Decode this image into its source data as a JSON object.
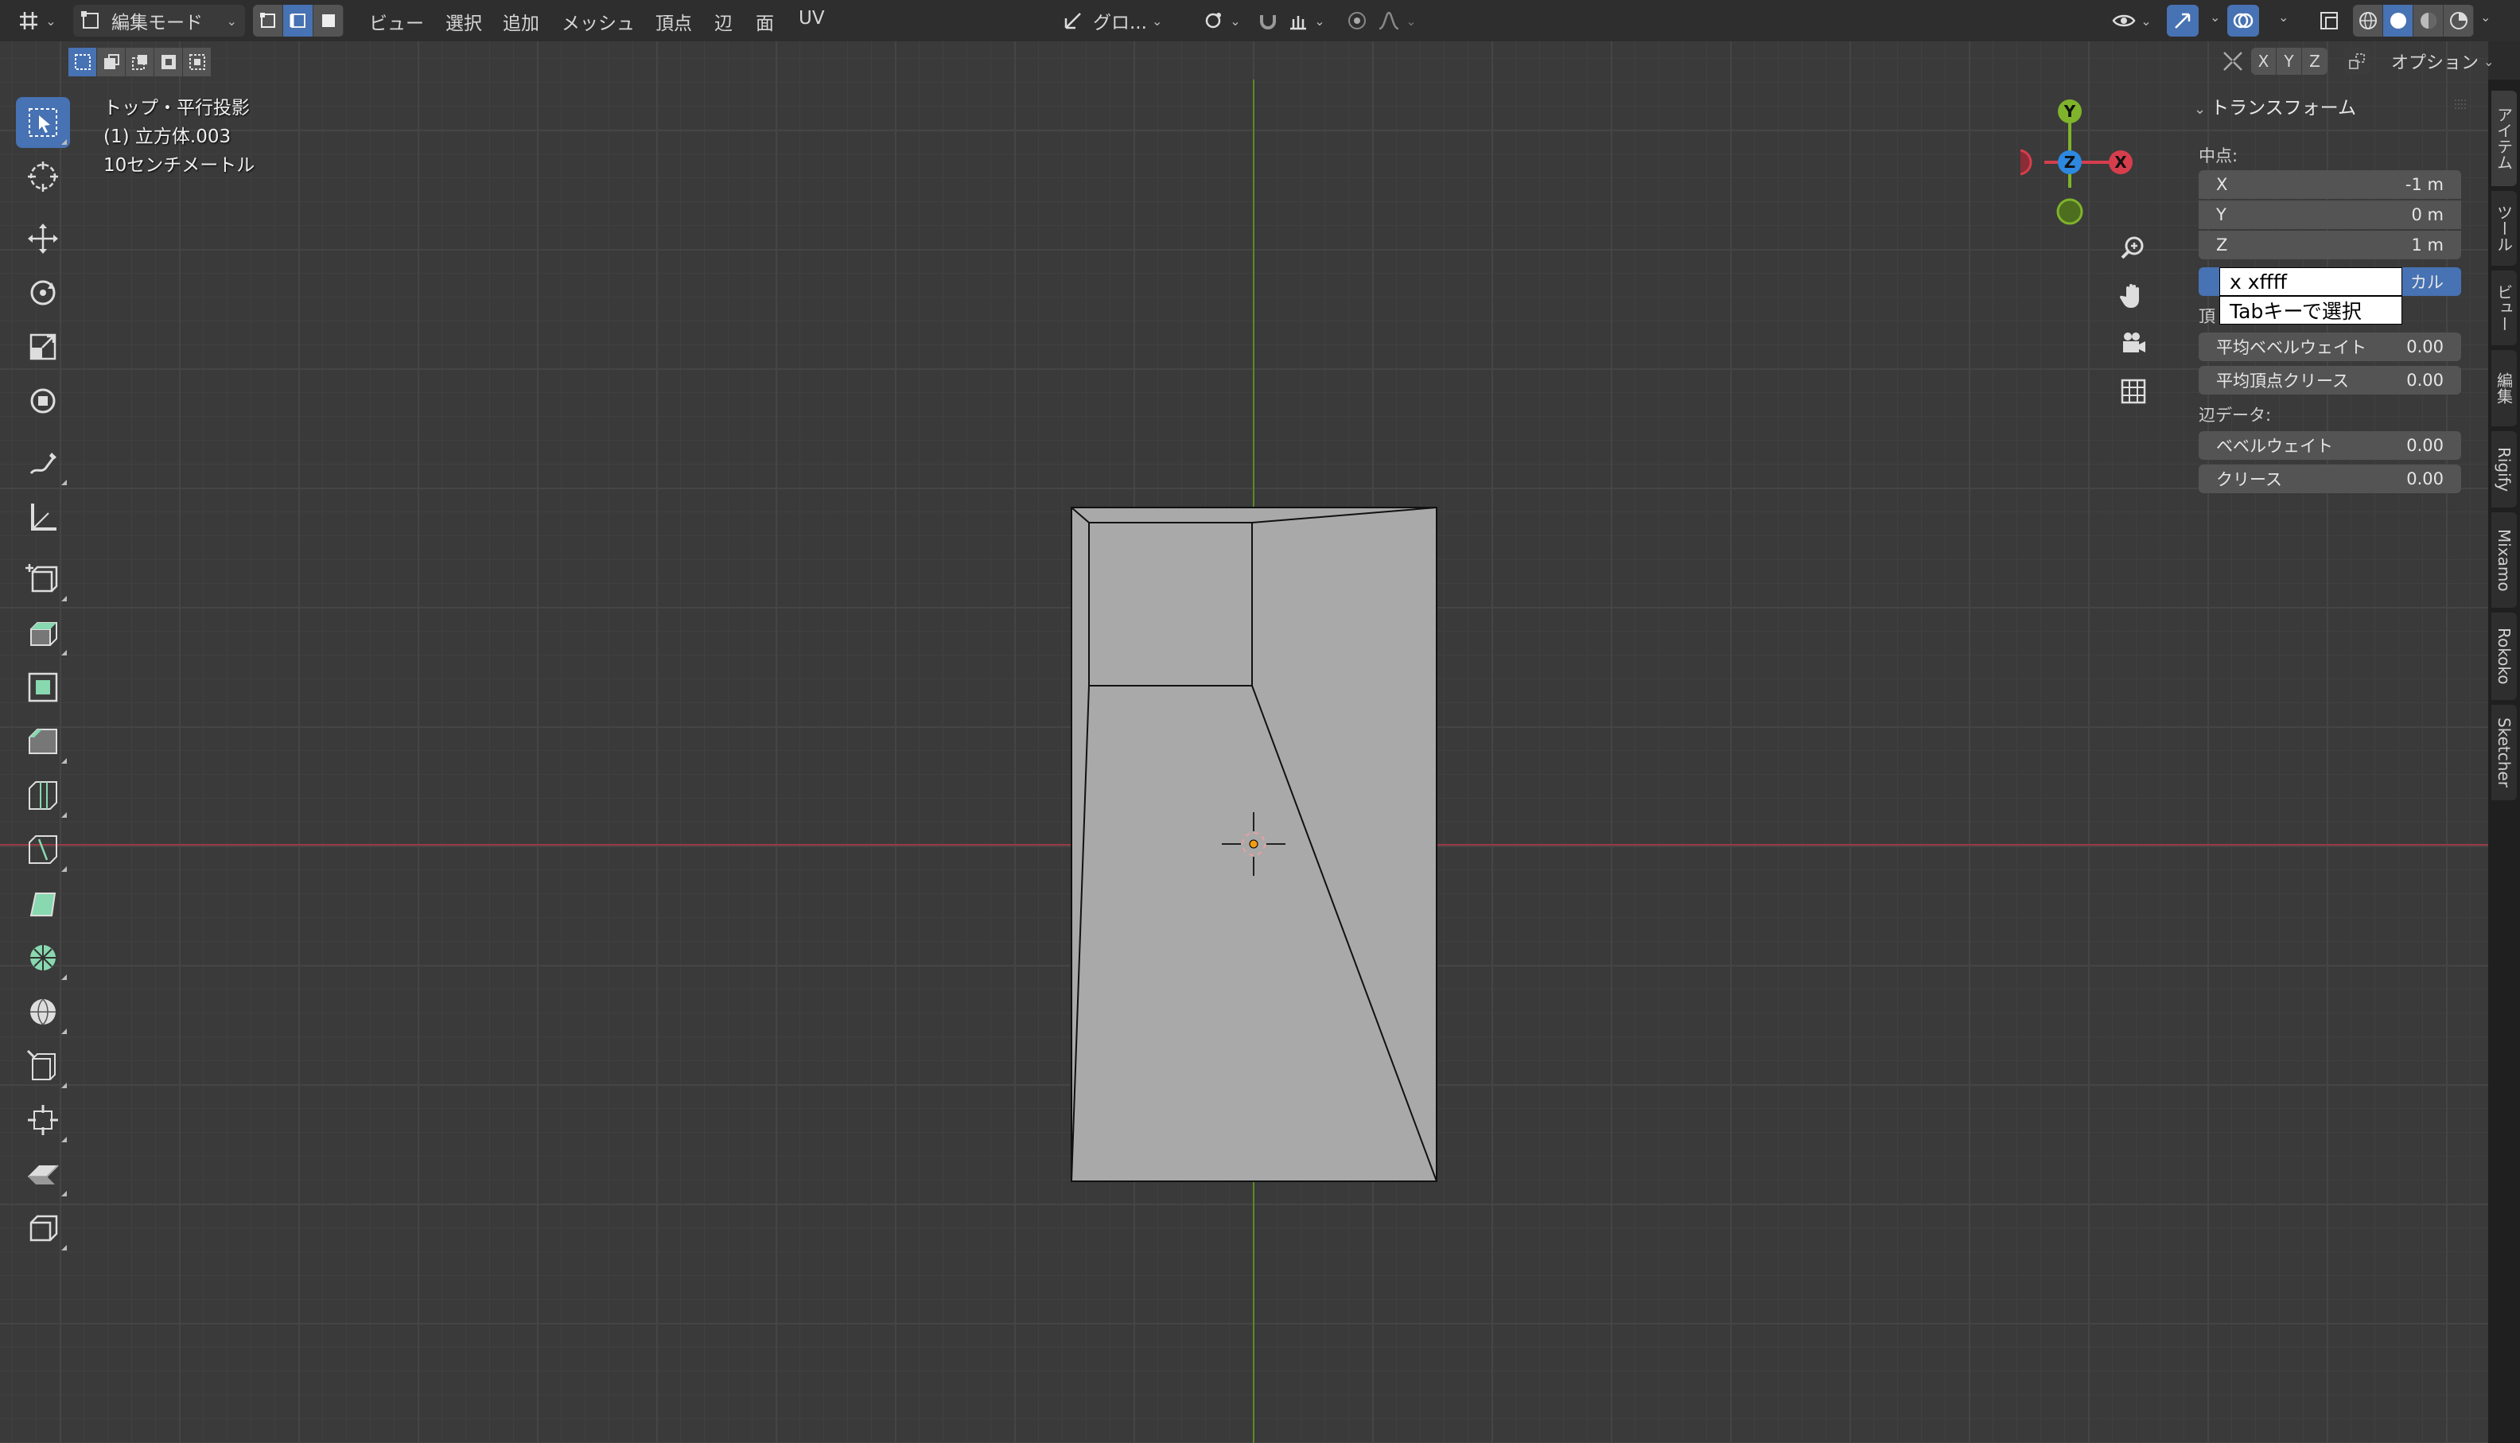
{
  "header": {
    "mode_label": "編集モード",
    "menus": [
      "ビュー",
      "選択",
      "追加",
      "メッシュ",
      "頂点",
      "辺",
      "面",
      "UV"
    ],
    "transform_orientation": "グロ...",
    "options_label": "オプション",
    "axis_toggles": [
      "X",
      "Y",
      "Z"
    ]
  },
  "viewport_info": {
    "view_name": "トップ・平行投影",
    "object_name": "(1) 立方体.003",
    "scale": "10センチメートル"
  },
  "gizmo": {
    "x_label": "X",
    "y_label": "Y",
    "z_label": "Z"
  },
  "npanel": {
    "title": "トランスフォーム",
    "median_label": "中点:",
    "x_label": "X",
    "x_value": "-1 m",
    "y_label": "Y",
    "y_value": "0 m",
    "z_label": "Z",
    "z_value": "1 m",
    "local_partial": "カル",
    "vertex_partial": "頂",
    "bevel_weight_avg_label": "平均ベベルウェイト",
    "bevel_weight_avg_value": "0.00",
    "vertex_crease_avg_label": "平均頂点クリース",
    "vertex_crease_avg_value": "0.00",
    "edge_data_label": "辺データ:",
    "bevel_weight_label": "ベベルウェイト",
    "bevel_weight_value": "0.00",
    "crease_label": "クリース",
    "crease_value": "0.00"
  },
  "tooltip": {
    "line1": "x xffff",
    "line2": "Tabキーで選択"
  },
  "side_tabs": [
    "アイテム",
    "ツール",
    "ビュー",
    "編集",
    "Rigify",
    "Mixamo",
    "Rokoko",
    "Sketcher"
  ],
  "colors": {
    "accent": "#4772b3",
    "axis_x": "#d63e4d",
    "axis_y": "#7fb32b",
    "axis_z": "#2d88e0",
    "mesh_face": "#a9a9a9"
  }
}
